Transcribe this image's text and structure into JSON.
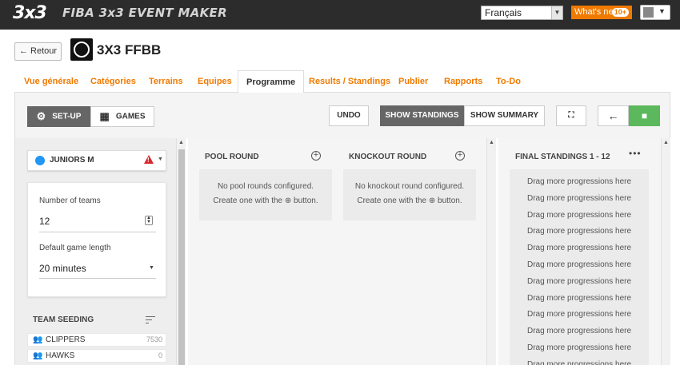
{
  "topbar": {
    "logo_text": "3x3",
    "app_title": "FIBA 3x3 EVENT MAKER",
    "language": "Français",
    "whats_new": "What's new",
    "whats_new_badge": "10+"
  },
  "header": {
    "back_label": "Retour",
    "event_title": "3X3 FFBB"
  },
  "tabs": [
    {
      "label": "Vue générale"
    },
    {
      "label": "Catégories"
    },
    {
      "label": "Terrains"
    },
    {
      "label": "Equipes"
    },
    {
      "label": "Programme",
      "active": true
    },
    {
      "label": "Results / Standings"
    },
    {
      "label": "Publier"
    },
    {
      "label": "Rapports"
    },
    {
      "label": "To-Do"
    }
  ],
  "toolbar": {
    "setup": "SET-UP",
    "games": "GAMES",
    "undo": "UNDO",
    "show_standings": "SHOW STANDINGS",
    "show_summary": "SHOW SUMMARY"
  },
  "division": {
    "name": "JUNIORS M",
    "color": "#2196f3",
    "warning_color": "#d9262c"
  },
  "settings": {
    "teams_label": "Number of teams",
    "teams_value": "12",
    "game_length_label": "Default game length",
    "game_length_value": "20 minutes"
  },
  "seeding": {
    "title": "TEAM SEEDING",
    "teams": [
      {
        "name": "CLIPPERS",
        "points": "7530"
      },
      {
        "name": "HAWKS",
        "points": "0"
      }
    ]
  },
  "pool_round": {
    "title": "POOL ROUND",
    "empty_line1": "No pool rounds configured.",
    "empty_line2": "Create one with the ⊕ button."
  },
  "knockout_round": {
    "title": "KNOCKOUT ROUND",
    "empty_line1": "No knockout round configured.",
    "empty_line2": "Create one with the ⊕ button."
  },
  "standings": {
    "title": "FINAL STANDINGS 1 - 12",
    "placeholder": "Drag more progressions here",
    "slots": [
      "Drag more progressions here",
      "Drag more progressions here",
      "Drag more progressions here",
      "Drag more progressions here",
      "Drag more progressions here",
      "Drag more progressions here",
      "Drag more progressions here",
      "Drag more progressions here",
      "Drag more progressions here",
      "Drag more progressions here",
      "Drag more progressions here",
      "Drag more progressions here"
    ]
  },
  "colors": {
    "accent": "#f07a00",
    "topbar": "#2c2c2c",
    "save_green": "#5cb85c"
  }
}
